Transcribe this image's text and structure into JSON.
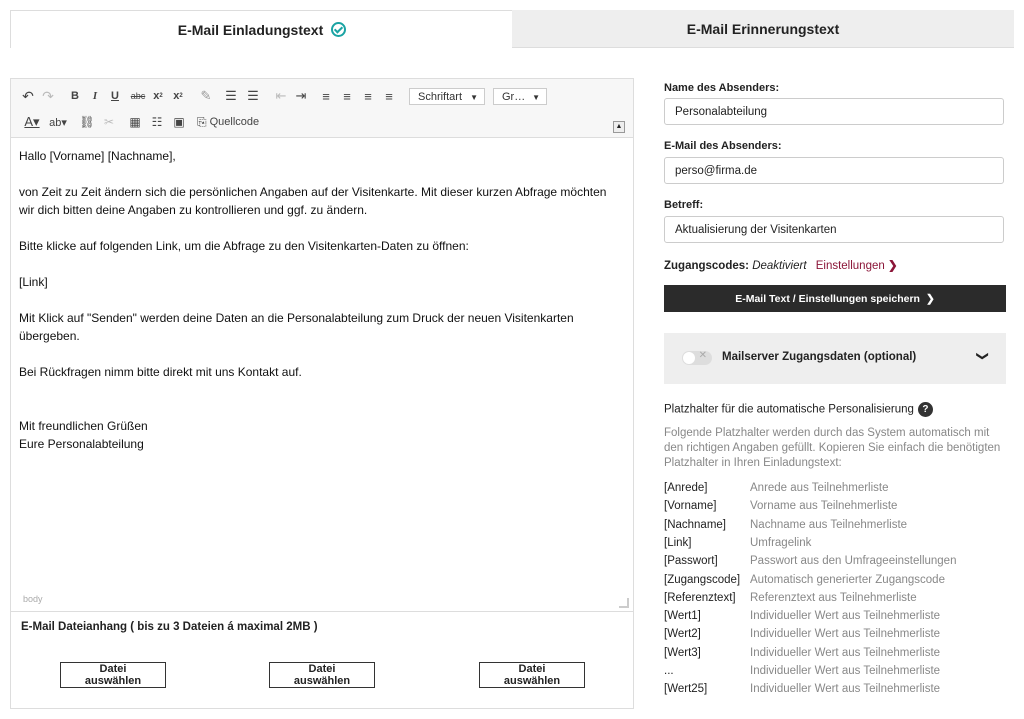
{
  "tabs": {
    "invitation": "E-Mail Einladungstext",
    "reminder": "E-Mail Erinnerungstext"
  },
  "editor": {
    "font_select": "Schriftart",
    "size_select": "Gr…",
    "source_label": "Quellcode",
    "lines": [
      "Hallo [Vorname] [Nachname],",
      "",
      "von Zeit zu Zeit ändern sich die persönlichen Angaben auf der Visitenkarte. Mit dieser kurzen Abfrage möchten wir dich bitten deine Angaben zu kontrollieren und ggf. zu ändern.",
      "",
      "Bitte klicke auf folgenden Link, um die Abfrage zu den Visitenkarten-Daten zu öffnen:",
      "",
      "[Link]",
      "",
      "Mit Klick auf \"Senden\" werden deine Daten an die Personalabteilung zum Druck der neuen Visitenkarten übergeben.",
      "",
      "Bei Rückfragen nimm bitte direkt mit uns Kontakt auf.",
      "",
      "",
      "Mit freundlichen Grüßen",
      "Eure Personalabteilung"
    ],
    "path": "body"
  },
  "attachment": {
    "title": "E-Mail Dateianhang ( bis zu 3 Dateien á maximal 2MB )",
    "button_label": "Datei auswählen"
  },
  "sender": {
    "name_label": "Name des Absenders:",
    "name_value": "Personalabteilung",
    "email_label": "E-Mail des Absenders:",
    "email_value": "perso@firma.de",
    "subject_label": "Betreff:",
    "subject_value": "Aktualisierung der Visitenkarten"
  },
  "codes": {
    "label": "Zugangscodes:",
    "value": "Deaktiviert",
    "link": "Einstellungen"
  },
  "save_button": "E-Mail Text / Einstellungen speichern",
  "mailserver": {
    "title": "Mailserver Zugangsdaten (optional)",
    "enabled": false
  },
  "placeholders": {
    "title": "Platzhalter für die automatische Personalisierung",
    "description": "Folgende Platzhalter werden durch das System automatisch mit den richtigen Angaben gefüllt. Kopieren Sie einfach die benötigten Platzhalter in Ihren Einladungstext:",
    "rows": [
      {
        "key": "[Anrede]",
        "desc": "Anrede aus Teilnehmerliste"
      },
      {
        "key": "[Vorname]",
        "desc": "Vorname aus Teilnehmerliste"
      },
      {
        "key": "[Nachname]",
        "desc": "Nachname aus Teilnehmerliste"
      },
      {
        "key": "[Link]",
        "desc": "Umfragelink"
      },
      {
        "key": "[Passwort]",
        "desc": "Passwort aus den Umfrageeinstellungen"
      },
      {
        "key": "[Zugangscode]",
        "desc": "Automatisch generierter Zugangscode"
      },
      {
        "key": "[Referenztext]",
        "desc": "Referenztext aus Teilnehmerliste"
      },
      {
        "key": "[Wert1]",
        "desc": "Individueller Wert aus Teilnehmerliste"
      },
      {
        "key": "[Wert2]",
        "desc": "Individueller Wert aus Teilnehmerliste"
      },
      {
        "key": "[Wert3]",
        "desc": "Individueller Wert aus Teilnehmerliste"
      },
      {
        "key": "...",
        "desc": "Individueller Wert aus Teilnehmerliste"
      },
      {
        "key": "[Wert25]",
        "desc": "Individueller Wert aus Teilnehmerliste"
      }
    ]
  }
}
